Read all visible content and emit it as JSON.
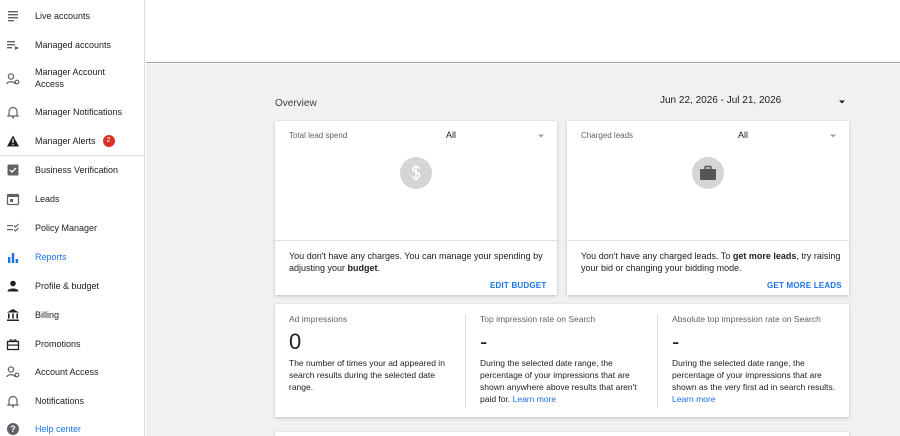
{
  "sidebar": {
    "items": [
      {
        "label": "Live accounts",
        "icon": "list-icon"
      },
      {
        "label": "Managed accounts",
        "icon": "playlist-icon"
      },
      {
        "label": "Manager Account Access",
        "icon": "manage-accounts-icon"
      },
      {
        "label": "Manager Notifications",
        "icon": "bell-icon"
      },
      {
        "label": "Manager Alerts",
        "icon": "warning-icon",
        "badge": "2"
      },
      {
        "label": "Business Verification",
        "icon": "checkbox-icon"
      },
      {
        "label": "Leads",
        "icon": "calendar-icon"
      },
      {
        "label": "Policy Manager",
        "icon": "checklist-icon"
      },
      {
        "label": "Reports",
        "icon": "bar-chart-icon",
        "active": true
      },
      {
        "label": "Profile & budget",
        "icon": "person-icon"
      },
      {
        "label": "Billing",
        "icon": "bank-icon"
      },
      {
        "label": "Promotions",
        "icon": "gift-icon"
      },
      {
        "label": "Account Access",
        "icon": "account-access-icon"
      },
      {
        "label": "Notifications",
        "icon": "bell-icon"
      },
      {
        "label": "Help center",
        "icon": "help-icon"
      }
    ]
  },
  "main": {
    "overview_label": "Overview",
    "date_range": "Jun 22, 2026 - Jul 21, 2026",
    "cards": {
      "lead_spend": {
        "title": "Total lead spend",
        "select_value": "All",
        "icon": "dollar-icon",
        "text_before": "You don't have any charges. You can manage your spending by adjusting your ",
        "text_bold": "budget",
        "text_after": ".",
        "action": "EDIT BUDGET"
      },
      "charged_leads": {
        "title": "Charged leads",
        "select_value": "All",
        "icon": "briefcase-icon",
        "text_before": "You don't have any charged leads. To ",
        "text_bold": "get more leads",
        "text_after": ", try raising your bid or changing your bidding mode.",
        "action": "GET MORE LEADS"
      }
    },
    "metrics": [
      {
        "title": "Ad impressions",
        "value": "0",
        "description": "The number of times your ad appeared in search results during the selected date range."
      },
      {
        "title": "Top impression rate on Search",
        "value": "-",
        "description": "During the selected date range, the percentage of your impressions that are shown anywhere above results that aren't paid for.",
        "link": "Learn more"
      },
      {
        "title": "Absolute top impression rate on Search",
        "value": "-",
        "description": "During the selected date range, the percentage of your impressions that are shown as the very first ad in search results.",
        "link": "Learn more"
      }
    ]
  },
  "colors": {
    "accent": "#1a73e8",
    "badge": "#d93025",
    "background": "#f1f1f1"
  }
}
